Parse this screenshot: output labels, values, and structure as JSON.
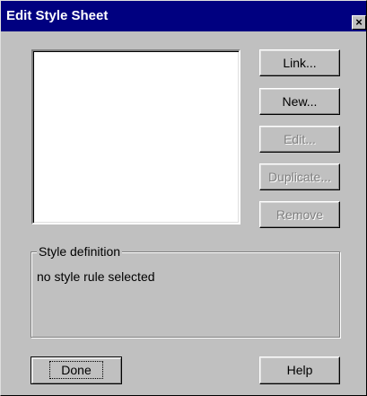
{
  "window": {
    "title": "Edit Style Sheet",
    "close_label": "×"
  },
  "buttons": {
    "link": "Link...",
    "new": "New...",
    "edit": "Edit...",
    "duplicate": "Duplicate...",
    "remove": "Remove",
    "done": "Done",
    "help": "Help"
  },
  "style_definition": {
    "label": "Style definition",
    "text": "no style rule selected"
  },
  "style_rules": []
}
